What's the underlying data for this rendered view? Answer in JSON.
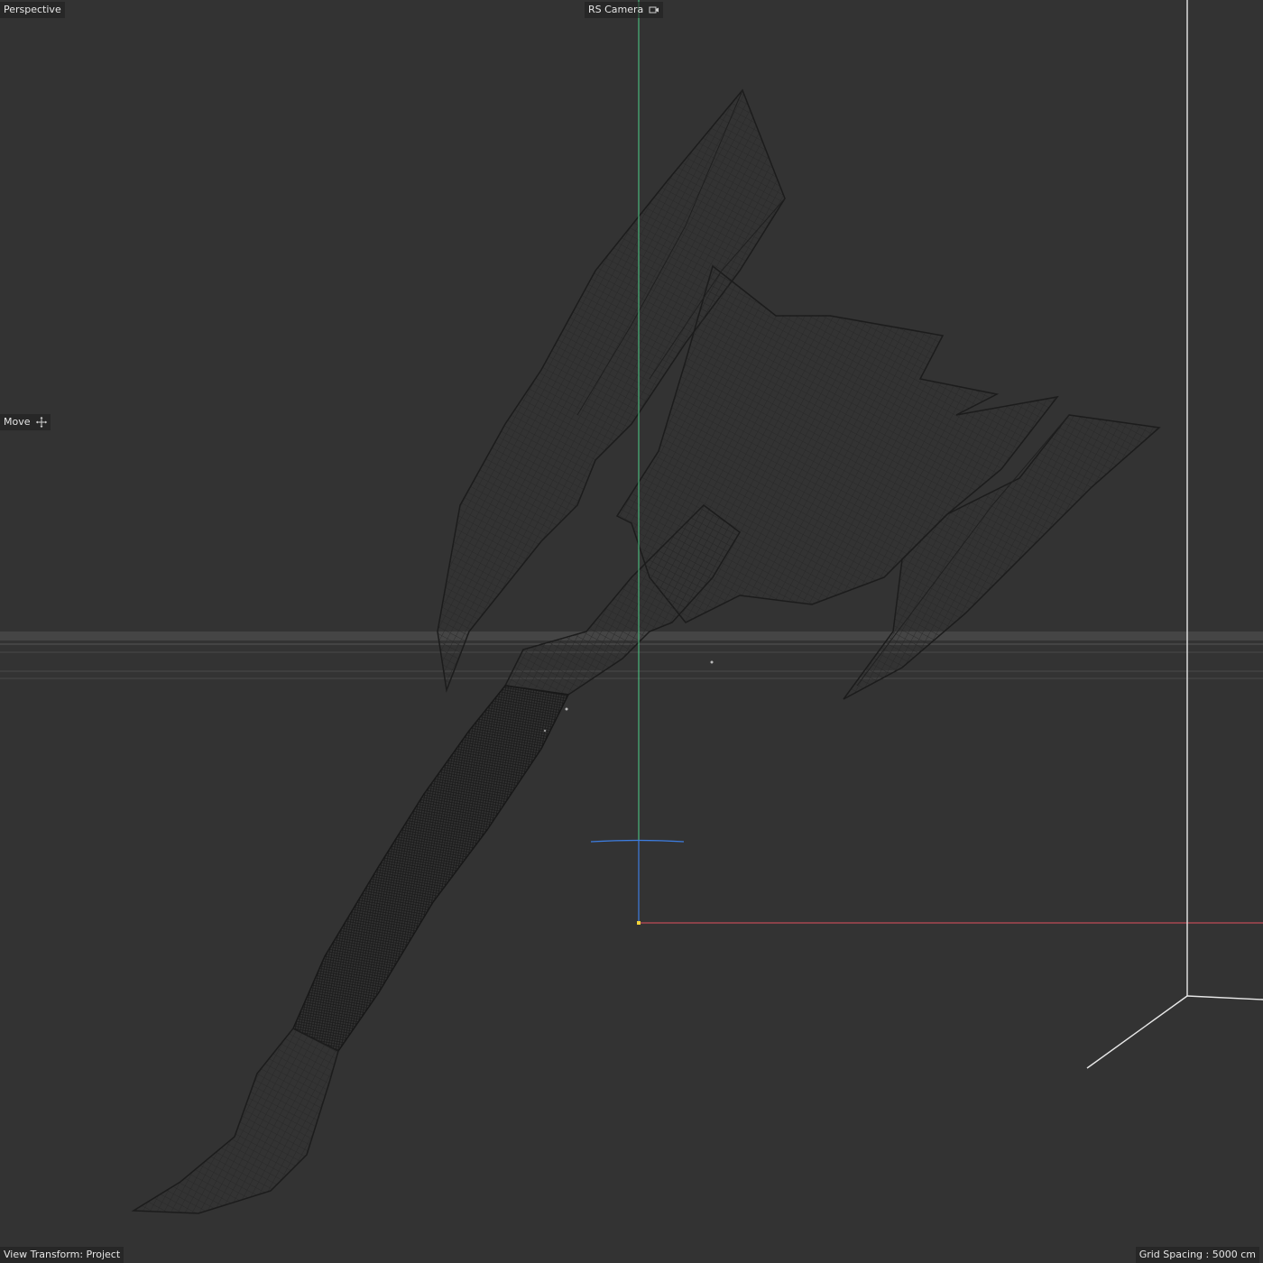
{
  "viewport": {
    "view_name": "Perspective",
    "camera_name": "RS Camera",
    "camera_icon": "camera-icon",
    "tool_name": "Move",
    "tool_icon": "move-icon",
    "view_transform": "View Transform: Project",
    "grid_spacing": "Grid Spacing : 5000 cm"
  },
  "colors": {
    "background": "#333333",
    "wireframe": "#1e1e1e",
    "axis_x": "#e0525f",
    "axis_y": "#4fd08a",
    "axis_z": "#3d7de0",
    "horizon": "#555555"
  }
}
